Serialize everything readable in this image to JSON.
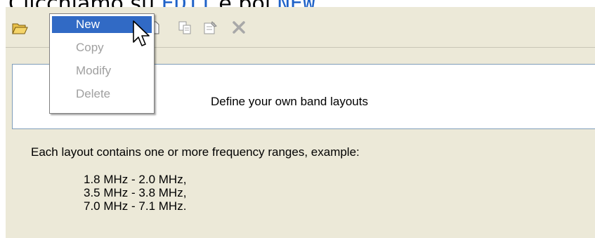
{
  "caption": {
    "prefix": "Clicchiamo su ",
    "highlight1": "EDIT",
    "middle": " e poi ",
    "highlight2": "NEW."
  },
  "toolbar": {
    "icons": [
      "open-folder-icon",
      "new-document-icon",
      "copy-icon",
      "properties-icon",
      "delete-icon"
    ]
  },
  "menu": {
    "items": [
      {
        "label": "New",
        "state": "highlighted"
      },
      {
        "label": "Copy",
        "state": "disabled"
      },
      {
        "label": "Modify",
        "state": "disabled"
      },
      {
        "label": "Delete",
        "state": "disabled"
      }
    ]
  },
  "panel": {
    "title": "Define your own band layouts"
  },
  "description": "Each layout contains one or more frequency ranges, example:",
  "ranges": [
    "1.8 MHz  -  2.0 MHz,",
    "3.5 MHz  -  3.8 MHz,",
    "7.0 MHz  -  7.1 MHz."
  ],
  "colors": {
    "window_bg": "#ece9d8",
    "menu_highlight": "#316ac5",
    "caption_highlight": "#1f62c8",
    "disabled_text": "#a0a0a0"
  }
}
